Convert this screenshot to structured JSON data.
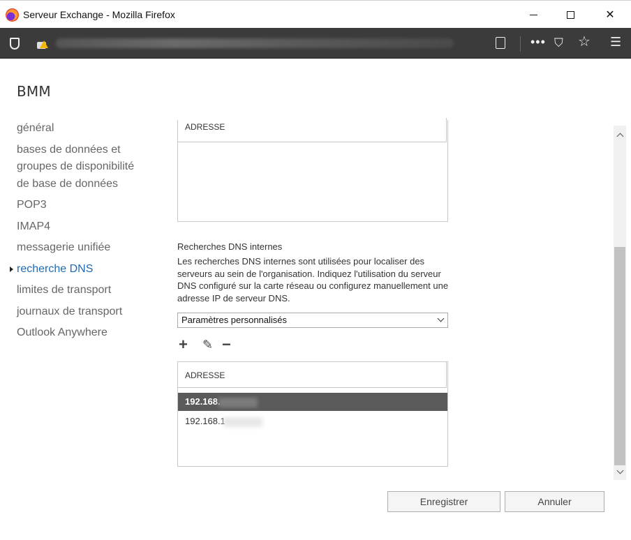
{
  "window": {
    "title": "Serveur Exchange - Mozilla Firefox",
    "minimize": "",
    "maximize": "",
    "close": "✕"
  },
  "toolbar": {
    "dots": "•••",
    "pocket": "⛉",
    "star": "☆",
    "menu": "☰"
  },
  "page": {
    "org_title": "BMM"
  },
  "nav": {
    "items": [
      {
        "label": "général"
      },
      {
        "label": "bases de données et groupes de disponibilité de base de données"
      },
      {
        "label": "POP3"
      },
      {
        "label": "IMAP4"
      },
      {
        "label": "messagerie unifiée"
      },
      {
        "label": "recherche DNS",
        "active": true
      },
      {
        "label": "limites de transport"
      },
      {
        "label": "journaux de transport"
      },
      {
        "label": "Outlook Anywhere"
      }
    ]
  },
  "external_dns": {
    "column_header": "ADRESSE"
  },
  "internal_dns": {
    "title": "Recherches DNS internes",
    "description": "Les recherches DNS internes sont utilisées pour localiser des serveurs au sein de l'organisation. Indiquez l'utilisation du serveur DNS configuré sur la carte réseau ou configurez manuellement une adresse IP de serveur DNS.",
    "mode_selected": "Paramètres personnalisés",
    "actions": {
      "add": "+",
      "edit": "✎",
      "remove": "−"
    },
    "column_header": "ADRESSE",
    "rows": [
      {
        "address": "192.168.",
        "selected": true
      },
      {
        "address": "192.168.1",
        "selected": false
      }
    ]
  },
  "buttons": {
    "save": "Enregistrer",
    "cancel": "Annuler"
  }
}
